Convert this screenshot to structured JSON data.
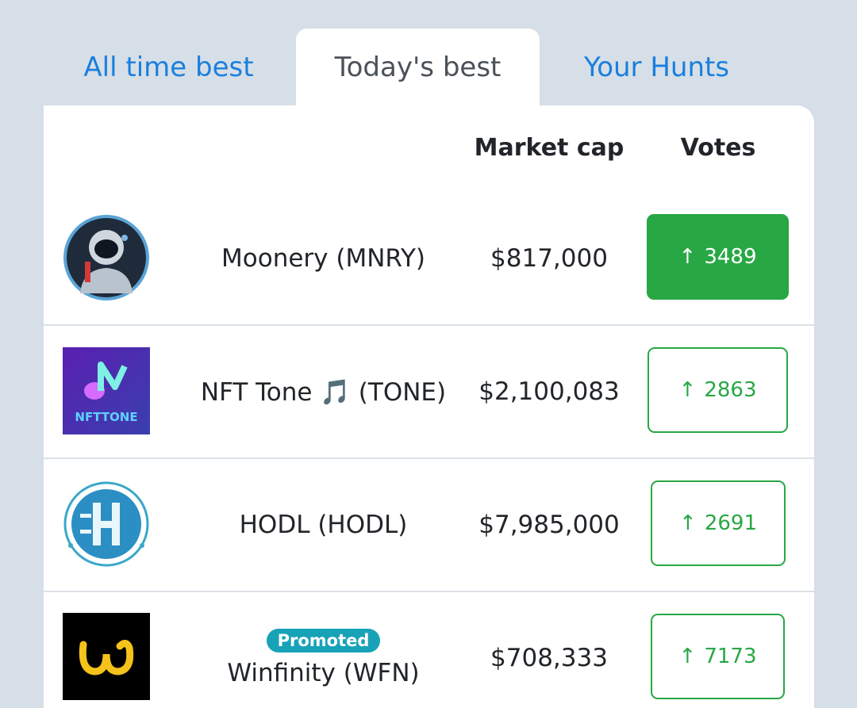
{
  "tabs": [
    {
      "label": "All time best",
      "active": false
    },
    {
      "label": "Today's best",
      "active": true
    },
    {
      "label": "Your Hunts",
      "active": false
    }
  ],
  "table": {
    "headers": {
      "market_cap": "Market cap",
      "votes": "Votes"
    },
    "rows": [
      {
        "name": "Moonery (MNRY)",
        "market_cap": "$817,000",
        "votes": "3489",
        "voted": true,
        "promoted": false,
        "logo": "astronaut-logo"
      },
      {
        "name": "NFT Tone 🎵 (TONE)",
        "market_cap": "$2,100,083",
        "votes": "2863",
        "voted": false,
        "promoted": false,
        "logo": "nfttone-logo"
      },
      {
        "name": "HODL (HODL)",
        "market_cap": "$7,985,000",
        "votes": "2691",
        "voted": false,
        "promoted": false,
        "logo": "hodl-logo"
      },
      {
        "name": "Winfinity (WFN)",
        "market_cap": "$708,333",
        "votes": "7173",
        "voted": false,
        "promoted": true,
        "badge": "Promoted",
        "logo": "winfinity-logo"
      }
    ]
  },
  "logo_text": {
    "nfttone": "NFTTONE"
  },
  "vote_arrow": "↑",
  "colors": {
    "accent": "#1a7fdd",
    "vote_green": "#28a745",
    "promoted": "#17a2b8",
    "background": "#d6dfe7"
  }
}
